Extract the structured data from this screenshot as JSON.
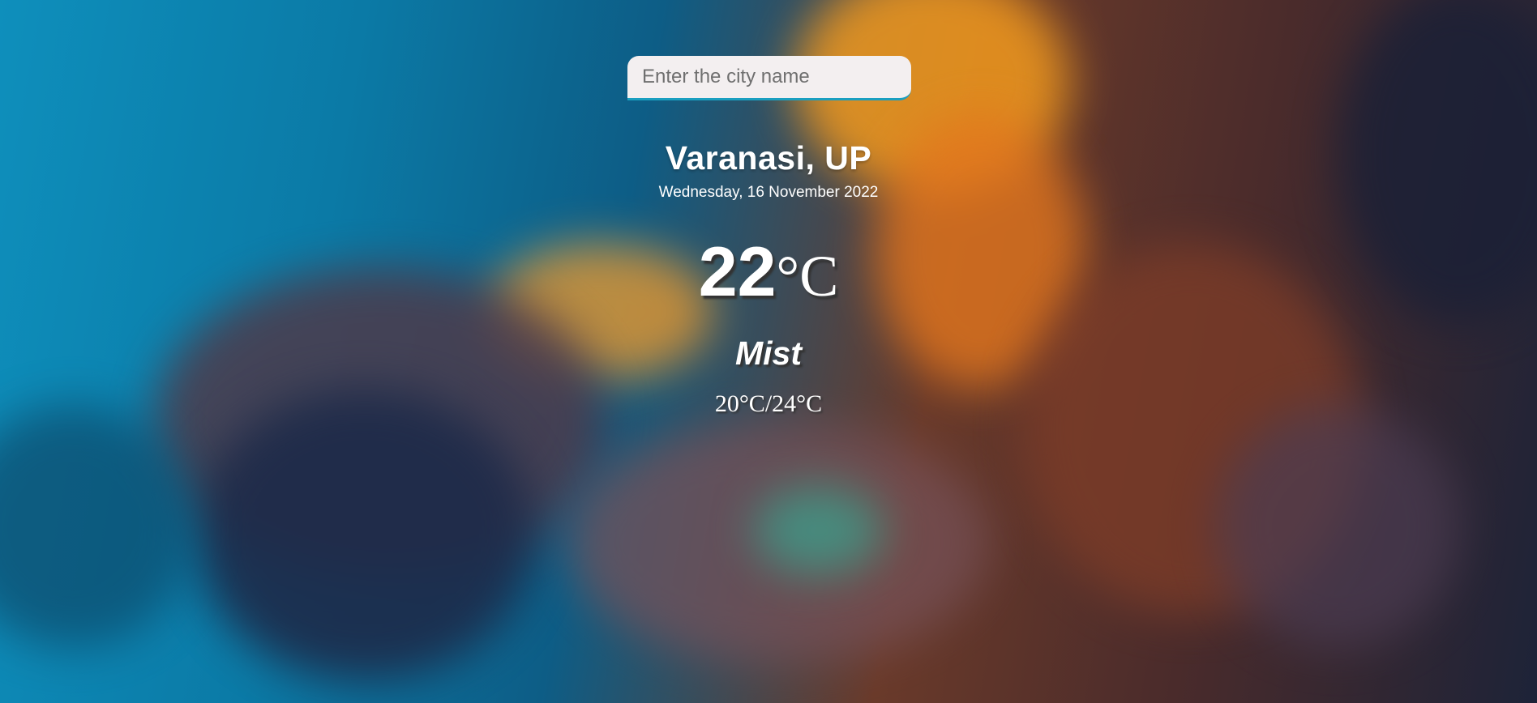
{
  "search": {
    "placeholder": "Enter the city name",
    "value": ""
  },
  "location": {
    "city": "Varanasi, UP",
    "date": "Wednesday, 16 November 2022"
  },
  "weather": {
    "temperature": "22",
    "unit": "°C",
    "condition": "Mist",
    "min_max": "20°C/24°C"
  },
  "colors": {
    "search_underline": "#1a9fc0",
    "search_background": "#f3eff0",
    "text": "#ffffff"
  }
}
